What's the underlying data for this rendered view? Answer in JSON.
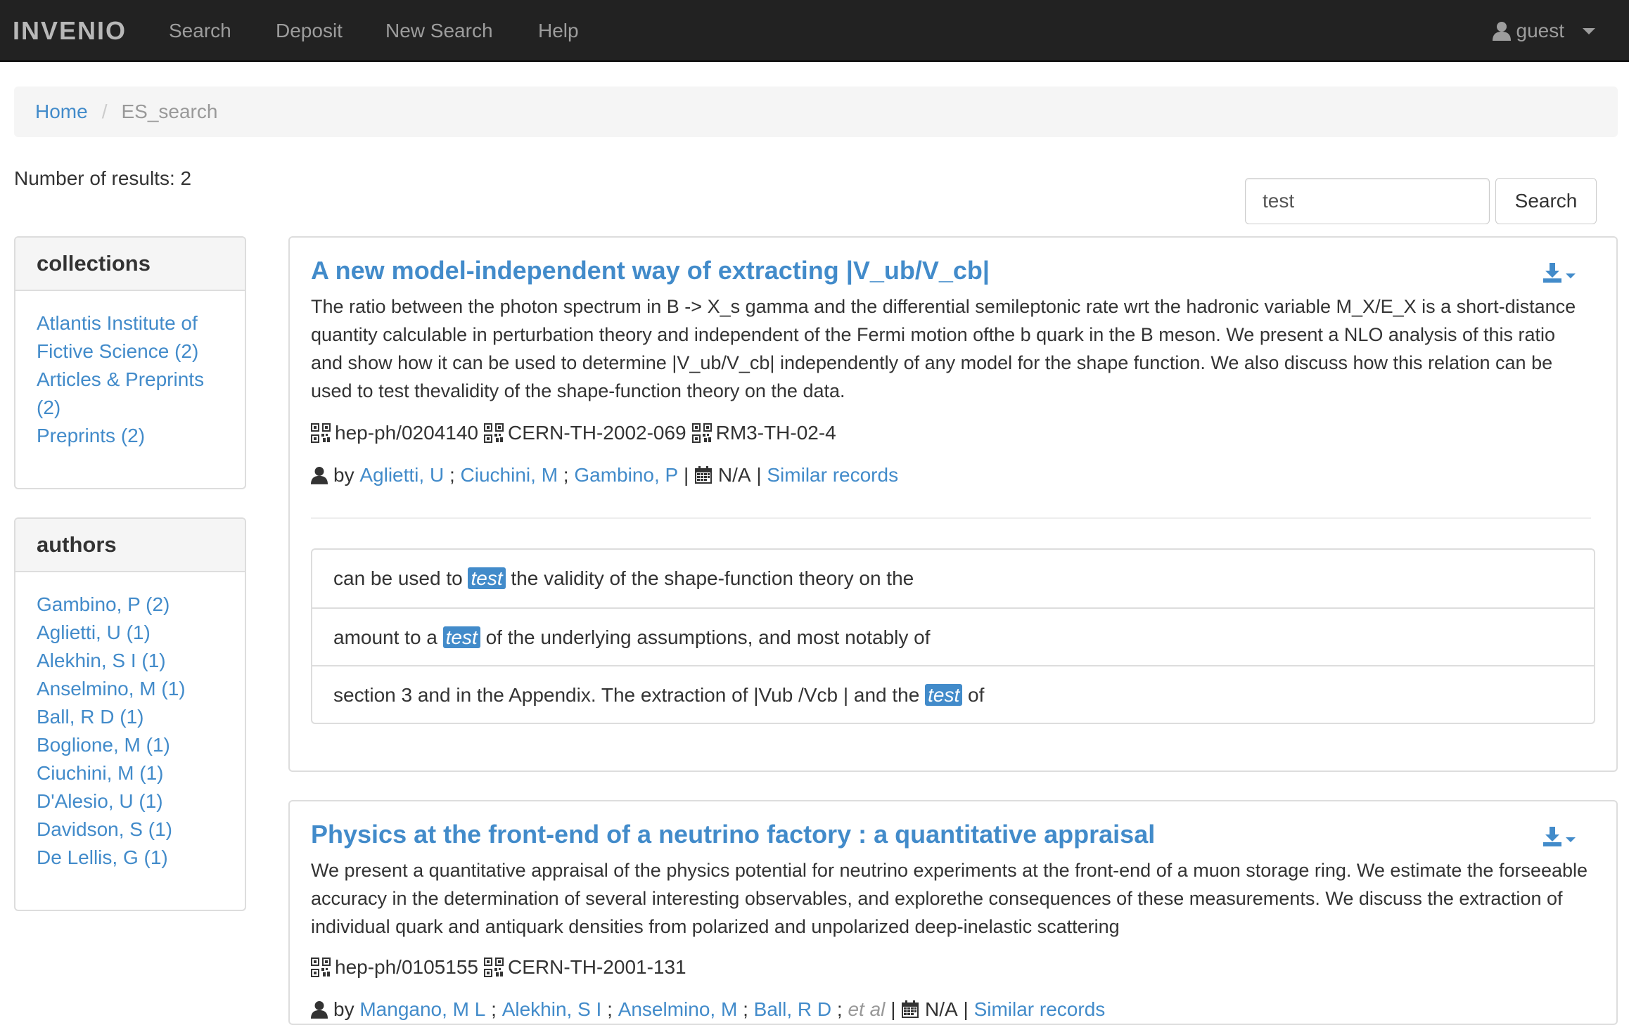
{
  "navbar": {
    "brand": "INVENIO",
    "links": [
      "Search",
      "Deposit",
      "New Search",
      "Help"
    ],
    "user": "guest"
  },
  "breadcrumb": {
    "home": "Home",
    "current": "ES_search"
  },
  "results": {
    "count_text": "Number of results: 2"
  },
  "search": {
    "value": "test",
    "button": "Search"
  },
  "facets": {
    "collections": {
      "title": "collections",
      "items": [
        "Atlantis Institute of Fictive Science (2)",
        "Articles & Preprints (2)",
        "Preprints (2)"
      ]
    },
    "authors": {
      "title": "authors",
      "items": [
        "Gambino, P (2)",
        "Aglietti, U (1)",
        "Alekhin, S I (1)",
        "Anselmino, M (1)",
        "Ball, R D (1)",
        "Boglione, M (1)",
        "Ciuchini, M (1)",
        "D'Alesio, U (1)",
        "Davidson, S (1)",
        "De Lellis, G (1)"
      ]
    }
  },
  "records": [
    {
      "title": "A new model-independent way of extracting |V_ub/V_cb|",
      "abstract": "The ratio between the photon spectrum in B -> X_s gamma and the differential semileptonic rate wrt the hadronic variable M_X/E_X is a short-distance quantity calculable in perturbation theory and independent of the Fermi motion ofthe b quark in the B meson. We present a NLO analysis of this ratio and show how it can be used to determine |V_ub/V_cb| independently of any model for the shape function. We also discuss how this relation can be used to test thevalidity of the shape-function theory on the data.",
      "ids": [
        "hep-ph/0204140",
        "CERN-TH-2002-069",
        "RM3-TH-02-4"
      ],
      "by": "by",
      "authors": [
        "Aglietti, U",
        "Ciuchini, M",
        "Gambino, P"
      ],
      "author_sep": ";",
      "date": "N/A",
      "pipe": "|",
      "similar": "Similar records",
      "snippets": [
        {
          "before": "can be used to ",
          "hl": "test",
          "after": " the validity of the shape-function theory on the"
        },
        {
          "before": "amount to a ",
          "hl": "test",
          "after": " of the underlying assumptions, and most notably of"
        },
        {
          "before": "section 3 and in the Appendix. The extraction of |Vub /Vcb | and the ",
          "hl": "test",
          "after": " of"
        }
      ]
    },
    {
      "title": "Physics at the front-end of a neutrino factory : a quantitative appraisal",
      "abstract": "We present a quantitative appraisal of the physics potential for neutrino experiments at the front-end of a muon storage ring. We estimate the forseeable accuracy in the determination of several interesting observables, and explorethe consequences of these measurements. We discuss the extraction of individual quark and antiquark densities from polarized and unpolarized deep-inelastic scattering",
      "ids": [
        "hep-ph/0105155",
        "CERN-TH-2001-131"
      ],
      "by": "by",
      "authors": [
        "Mangano, M L",
        "Alekhin, S I",
        "Anselmino, M",
        "Ball, R D"
      ],
      "author_sep": ";",
      "etal": "et al",
      "date": "N/A",
      "pipe": "|",
      "similar": "Similar records"
    }
  ],
  "icons": {
    "user": "user-icon",
    "caret": "caret-down-icon",
    "download": "download-icon",
    "qrcode": "qrcode-icon",
    "calendar": "calendar-icon"
  },
  "colors": {
    "navbar": "#222222",
    "link": "#428bca",
    "highlight": "#428bca"
  }
}
